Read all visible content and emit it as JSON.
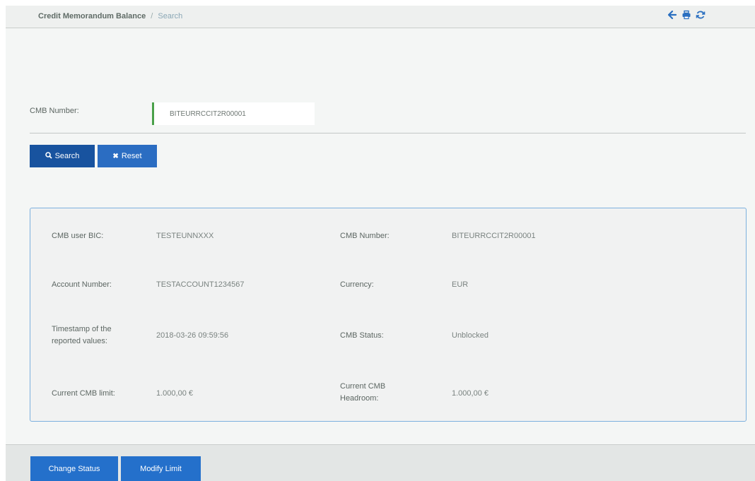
{
  "breadcrumb": {
    "parent": "Credit Memorandum Balance",
    "separator": "/",
    "current": "Search"
  },
  "toolbar": {
    "icons": [
      "back-arrow-icon",
      "print-icon",
      "refresh-icon"
    ]
  },
  "search": {
    "label": "CMB Number:",
    "value": "BITEURRCCIT2R00001"
  },
  "buttons": {
    "search": "Search",
    "reset": "Reset",
    "change_status": "Change Status",
    "modify_limit": "Modify Limit"
  },
  "details": {
    "cmb_user_bic_label": "CMB user BIC:",
    "cmb_user_bic_value": "TESTEUNNXXX",
    "cmb_number_label": "CMB Number:",
    "cmb_number_value": "BITEURRCCIT2R00001",
    "account_number_label": "Account Number:",
    "account_number_value": "TESTACCOUNT1234567",
    "currency_label": "Currency:",
    "currency_value": "EUR",
    "timestamp_label_1": "Timestamp of the",
    "timestamp_label_2": "reported values:",
    "timestamp_value": "2018-03-26 09:59:56",
    "cmb_status_label": "CMB Status:",
    "cmb_status_value": "Unblocked",
    "current_limit_label": "Current CMB limit:",
    "current_limit_value": "1.000,00 €",
    "current_headroom_label_1": "Current CMB",
    "current_headroom_label_2": "Headroom:",
    "current_headroom_value": "1.000,00 €"
  },
  "colors": {
    "primary": "#1d5fb1",
    "accent_green": "#4aa14a",
    "panel_border": "#7cb0de"
  }
}
